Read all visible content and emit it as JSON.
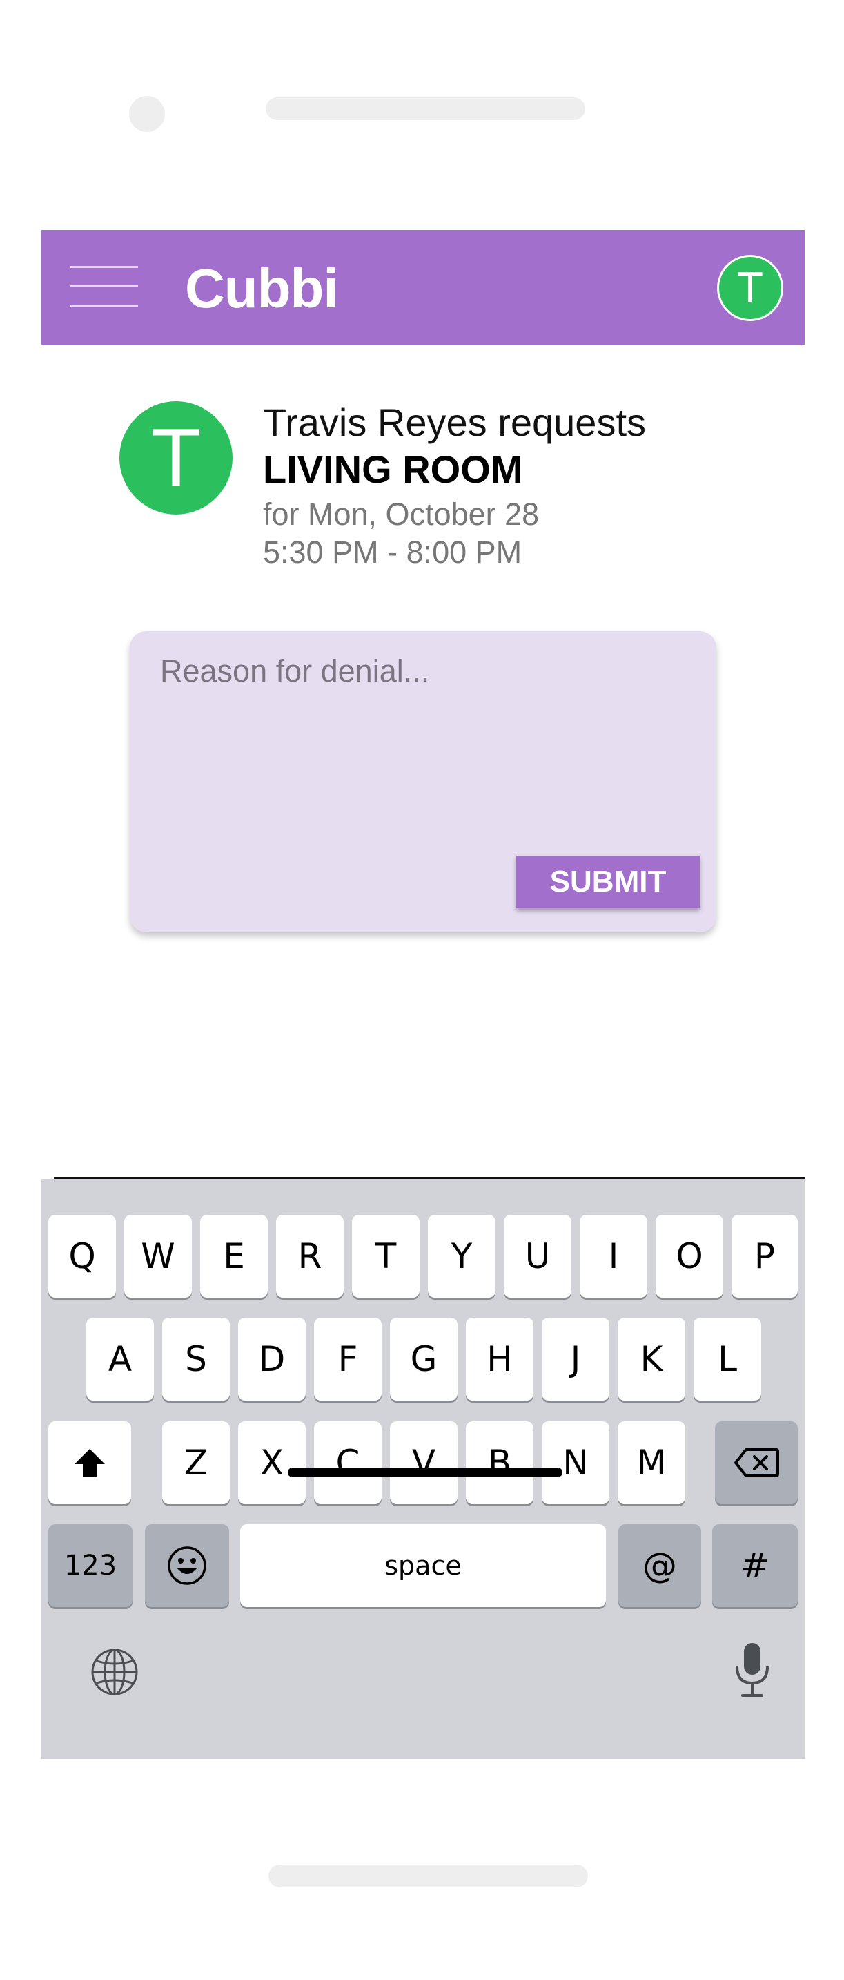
{
  "app": {
    "title": "Cubbi",
    "user_initial": "T",
    "brand_color": "#a26fcc",
    "avatar_color": "#2bbf5e"
  },
  "request": {
    "avatar_initial": "T",
    "requester_line": "Travis Reyes requests",
    "room": "LIVING ROOM",
    "date_line": "for Mon,  October 28",
    "time_line": "5:30 PM - 8:00 PM"
  },
  "denial_form": {
    "placeholder": "Reason for denial...",
    "value": "",
    "submit_label": "SUBMIT"
  },
  "keyboard": {
    "row1": [
      "Q",
      "W",
      "E",
      "R",
      "T",
      "Y",
      "U",
      "I",
      "O",
      "P"
    ],
    "row2": [
      "A",
      "S",
      "D",
      "F",
      "G",
      "H",
      "J",
      "K",
      "L"
    ],
    "row3": [
      "Z",
      "X",
      "C",
      "V",
      "B",
      "N",
      "M"
    ],
    "shift_icon": "shift-arrow-icon",
    "backspace_icon": "backspace-icon",
    "numbers_label": "123",
    "emoji_icon": "emoji-icon",
    "space_label": "space",
    "at_label": "@",
    "hash_label": "#",
    "globe_icon": "globe-icon",
    "mic_icon": "microphone-icon"
  }
}
